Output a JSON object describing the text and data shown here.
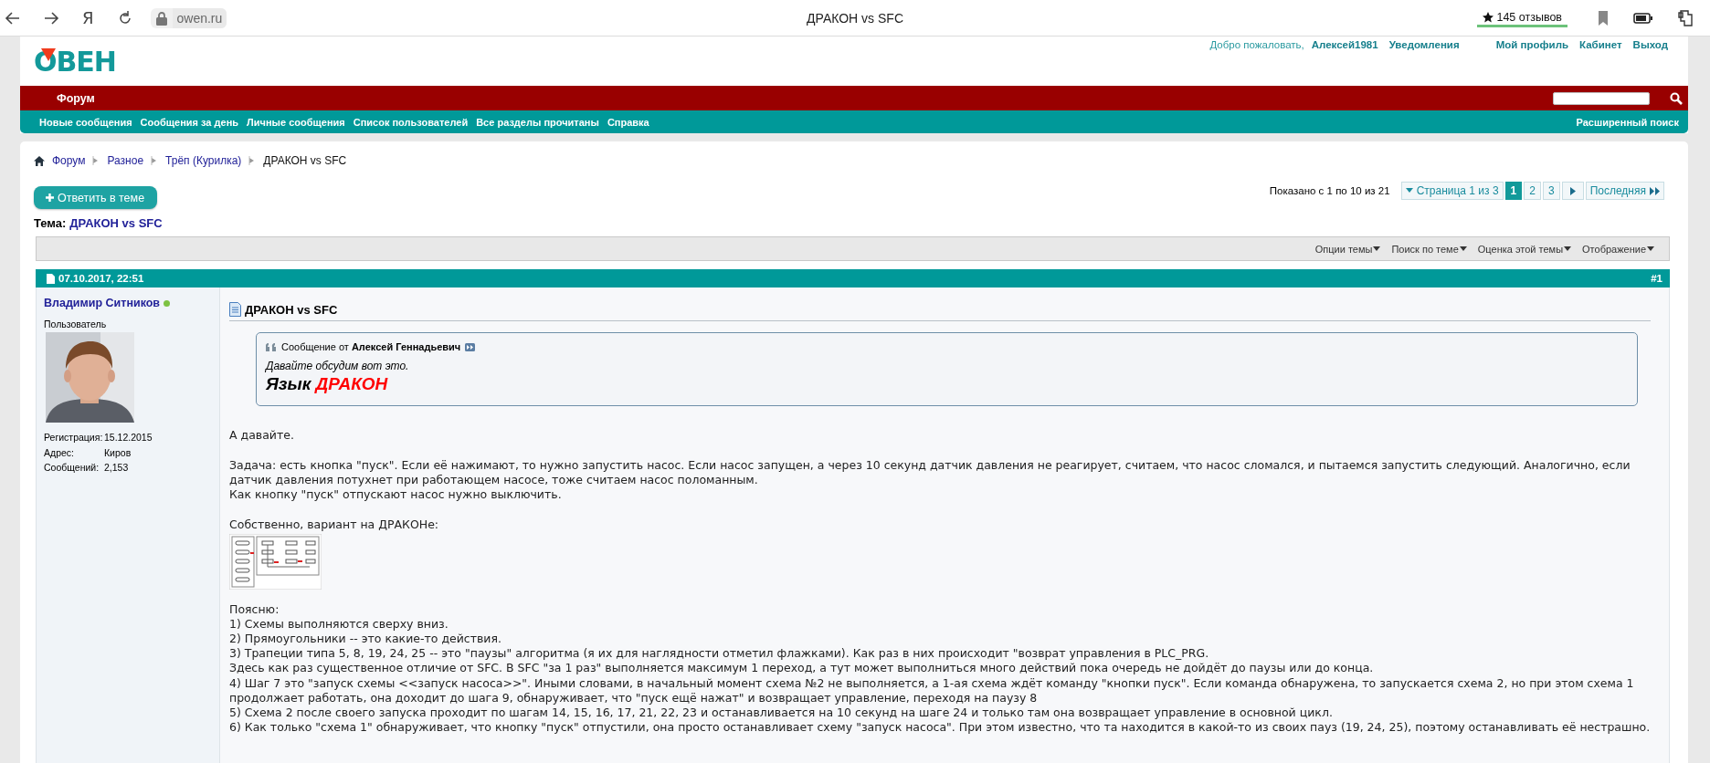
{
  "browser": {
    "home_letter": "Я",
    "url": "owen.ru",
    "title": "ДРАКОН vs SFC",
    "rating": "145 отзывов"
  },
  "header": {
    "logo": "ОВЕН",
    "welcome": "Добро пожаловать,",
    "user": "Алексей1981",
    "links": [
      "Уведомления",
      "Мой профиль",
      "Кабинет",
      "Выход"
    ]
  },
  "forum_bar": {
    "title": "Форум"
  },
  "nav": {
    "links": [
      "Новые сообщения",
      "Сообщения за день",
      "Личные сообщения",
      "Список пользователей",
      "Все разделы прочитаны",
      "Справка"
    ],
    "advanced_search": "Расширенный поиск"
  },
  "breadcrumb": [
    "Форум",
    "Разное",
    "Трёп (Курилка)",
    "ДРАКОН vs SFC"
  ],
  "reply_button": "Ответить в теме",
  "pagination": {
    "summary": "Показано с 1 по 10 из 21",
    "page_label": "Страница 1 из 3",
    "pages": [
      {
        "label": "1",
        "selected": true
      },
      {
        "label": "2",
        "selected": false
      },
      {
        "label": "3",
        "selected": false
      }
    ],
    "last": "Последняя"
  },
  "topic": {
    "label": "Тема:",
    "title": "ДРАКОН vs SFC"
  },
  "thread_tools": [
    "Опции темы",
    "Поиск по теме",
    "Оценка этой темы",
    "Отображение"
  ],
  "post": {
    "date": "07.10.2017, 22:51",
    "number": "#1",
    "author": {
      "name": "Владимир Ситников",
      "online": true,
      "role": "Пользователь",
      "details": [
        {
          "label": "Регистрация:",
          "value": "15.12.2015"
        },
        {
          "label": "Адрес:",
          "value": "Киров"
        },
        {
          "label": "Сообщений:",
          "value": "2,153"
        }
      ]
    },
    "title": "ДРАКОН vs SFC",
    "quote": {
      "prefix": "Сообщение от",
      "author": "Алексей Геннадьевич",
      "text": "Давайте обсудим вот это.",
      "big_text": "Язык",
      "big_highlight": "ДРАКОН"
    },
    "blocks": [
      {
        "kind": "paragraph",
        "lines": [
          "А давайте."
        ]
      },
      {
        "kind": "paragraph",
        "lines": [
          "Задача: есть кнопка \"пуск\". Если её нажимают, то нужно запустить насос. Если насос запущен, а через 10 секунд датчик давления не реагирует, считаем, что насос сломался, и пытаемся запустить следующий. Аналогично, если датчик давления потухнет при работающем насосе, тоже считаем насос поломанным.",
          "Как кнопку \"пуск\" отпускают насос нужно выключить."
        ]
      },
      {
        "kind": "paragraph",
        "lines": [
          "Собственно, вариант на ДРАКОНе:"
        ]
      },
      {
        "kind": "picture"
      },
      {
        "kind": "paragraph",
        "lines": [
          "Поясню:",
          "1) Схемы выполняются сверху вниз.",
          "2) Прямоугольники -- это какие-то действия.",
          "3) Трапеции типа 5, 8, 19, 24, 25 -- это \"паузы\" алгоритма (я их для наглядности отметил флажками). Как раз в них происходит \"возврат управления в PLC_PRG.",
          "Здесь как раз существенное отличие от SFC. В SFC \"за 1 раз\" выполняется максимум 1 переход, а тут может выполниться много действий пока очередь не дойдёт до паузы или до конца.",
          "4) Шаг 7 это \"запуск схемы <<запуск насоса>>\". Иными словами, в начальный момент схема №2 не выполняется, а 1-ая схема ждёт команду \"кнопки пуск\". Если команда обнаружена, то запускается схема 2, но при этом схема 1 продолжает работать, она доходит до шага 9, обнаруживает, что \"пуск ещё нажат\" и возвращает управление, переходя на паузу 8",
          "5) Схема 2 после своего запуска проходит по шагам 14, 15, 16, 17, 21, 22, 23 и останавливается на 10 секунд на шаге 24 и только там она возвращает управление в основной цикл.",
          "6) Как только \"схема 1\" обнаруживает, что кнопку \"пуск\" отпустили, она просто останавливает схему \"запуск насоса\". При этом известно, что та находится в какой-то из своих пауз (19, 24, 25), поэтому останавливать её нестрашно."
        ]
      }
    ]
  }
}
